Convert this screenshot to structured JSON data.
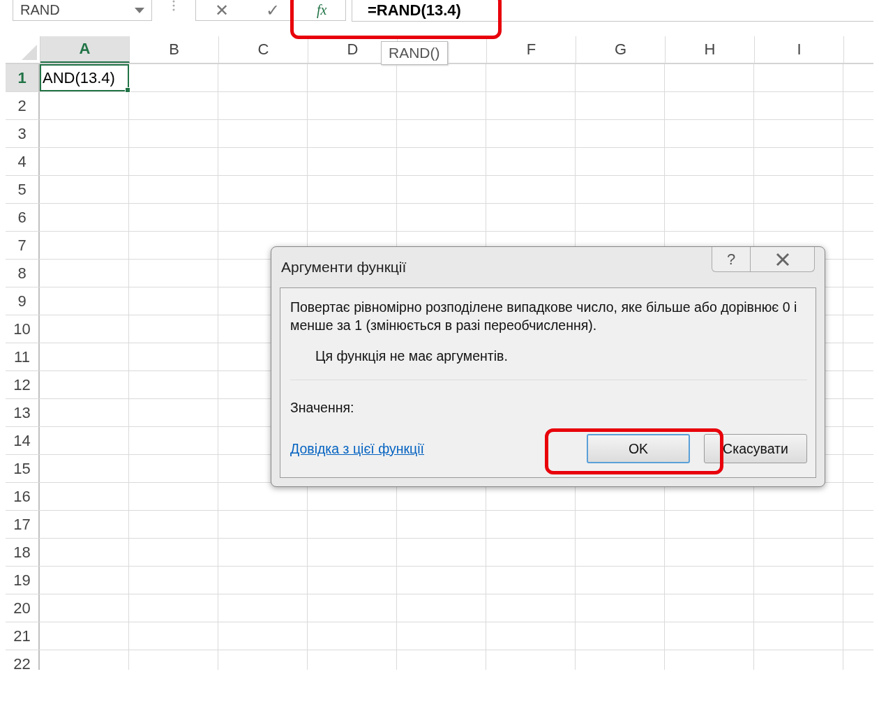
{
  "name_box": {
    "value": "RAND"
  },
  "formula_bar": {
    "cancel": "✕",
    "enter": "✓",
    "fx": "fx",
    "value": "=RAND(13.4)",
    "highlighted": true
  },
  "columns": [
    {
      "label": "A",
      "selected": true
    },
    {
      "label": "B",
      "selected": false
    },
    {
      "label": "C",
      "selected": false
    },
    {
      "label": "D",
      "selected": false
    },
    {
      "selected": false
    },
    {
      "label": "F",
      "selected": false
    },
    {
      "label": "G",
      "selected": false
    },
    {
      "label": "H",
      "selected": false
    },
    {
      "label": "I",
      "selected": false
    }
  ],
  "rows": [
    "1",
    "2",
    "3",
    "4",
    "5",
    "6",
    "7",
    "8",
    "9",
    "10",
    "11",
    "12",
    "13",
    "14",
    "15",
    "16",
    "17",
    "18",
    "19",
    "20",
    "21",
    "22"
  ],
  "active_cell": {
    "value": "AND(13.4)"
  },
  "tooltip": "RAND()",
  "dialog": {
    "title": "Аргументи функції",
    "help": "?",
    "description": "Повертає рівномірно розподілене випадкове число, яке більше або дорівнює 0 і менше за 1 (змінюється в разі переобчислення).",
    "no_args": "Ця функція не має аргументів.",
    "result_label": "Значення:",
    "help_link": "Довідка з цієї функції",
    "ok": "OK",
    "cancel": "Скасувати",
    "ok_highlighted": true
  }
}
